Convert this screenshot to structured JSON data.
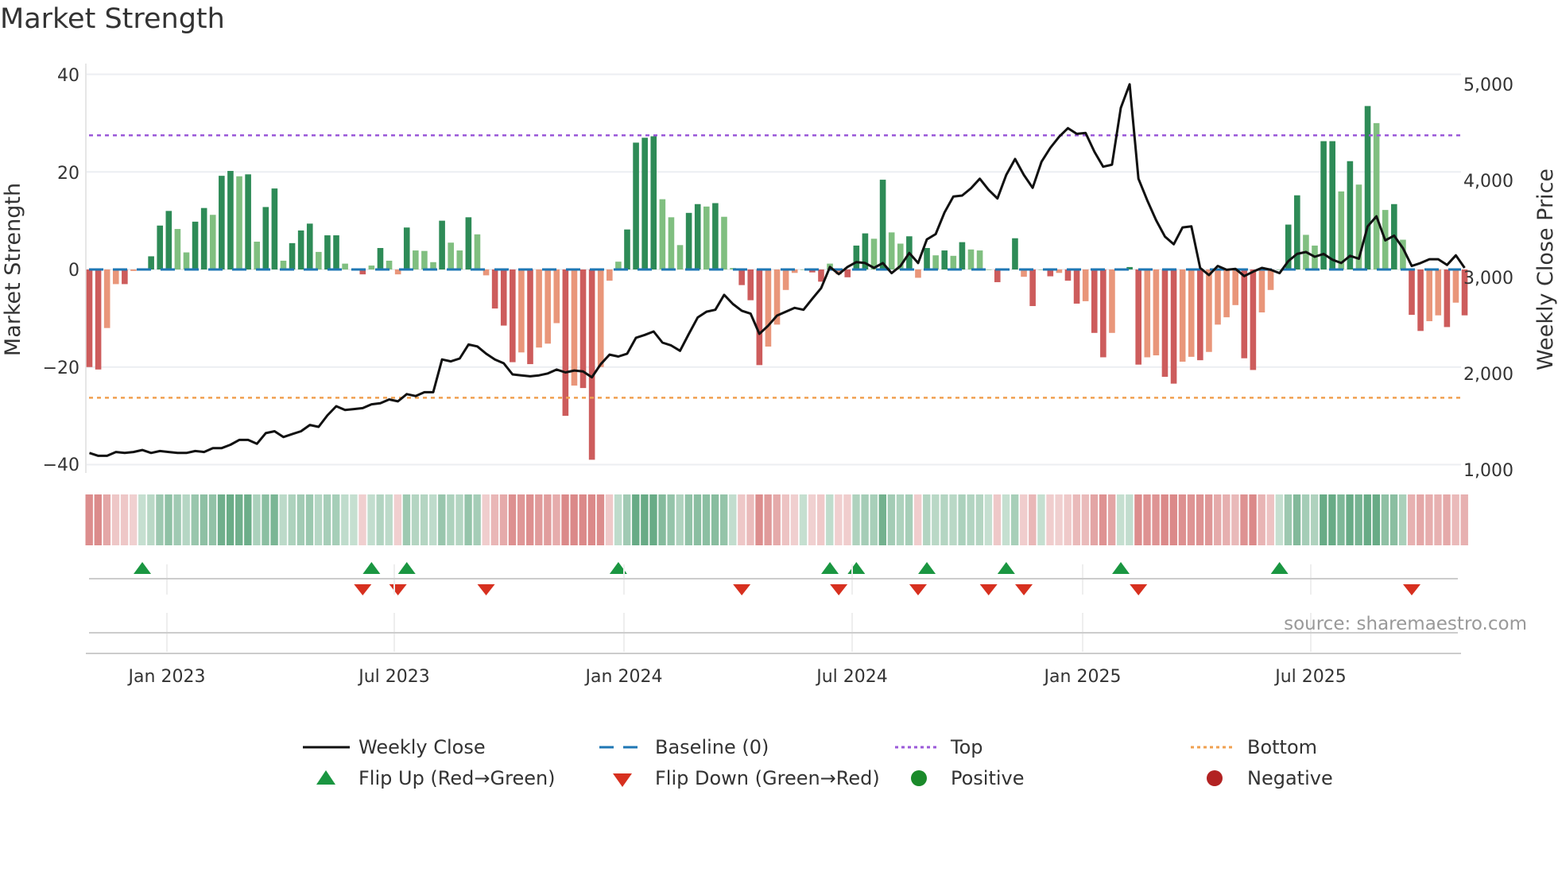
{
  "chart_data": {
    "type": "bar",
    "title": "Market Strength",
    "ylabel": "Market Strength",
    "y2label": "Weekly Close Price",
    "ylim": [
      -40,
      40
    ],
    "y2lim": [
      1000,
      5000
    ],
    "yticks": [
      "40",
      "20",
      "0",
      "−20",
      "−40"
    ],
    "y2ticks": [
      "5,000",
      "4,000",
      "3,000",
      "2,000",
      "1,000"
    ],
    "xticks": [
      "Jan 2023",
      "Jul 2023",
      "Jan 2024",
      "Jul 2024",
      "Jan 2025",
      "Jul 2025"
    ],
    "top_level": 27.5,
    "bottom_level": -26.3,
    "strength": [
      -20,
      -20.5,
      -12,
      -3,
      -3,
      -0.3,
      0,
      2.7,
      9,
      12,
      8.3,
      3.5,
      9.8,
      12.6,
      11.2,
      19.2,
      20.2,
      19.1,
      19.5,
      5.7,
      12.8,
      16.6,
      1.8,
      5.4,
      8,
      9.4,
      3.6,
      7,
      7,
      1.2,
      0,
      -1,
      0.8,
      4.4,
      1.8,
      -1,
      8.6,
      3.9,
      3.8,
      1.5,
      10,
      5.5,
      3.9,
      10.7,
      7.2,
      -1.2,
      -8,
      -11.5,
      -19,
      -17,
      -19.4,
      -16,
      -15.2,
      -11,
      -30,
      -23.8,
      -24.3,
      -39,
      -20,
      -2.3,
      1.6,
      8.2,
      26,
      27,
      27.3,
      14.4,
      10.7,
      5,
      11.6,
      13.4,
      12.9,
      13.6,
      10.8,
      0.3,
      -3.2,
      -6.3,
      -19.6,
      -15.8,
      -11.3,
      -4.2,
      -0.7,
      0,
      -0.6,
      -2.5,
      1.2,
      -1,
      -1.6,
      4.9,
      7.4,
      6.3,
      18.4,
      7.6,
      5.3,
      6.8,
      -1.7,
      4.4,
      2.9,
      3.9,
      2.8,
      5.6,
      4.1,
      3.9,
      0,
      -2.6,
      0,
      6.4,
      -1.5,
      -7.5,
      0,
      -1.4,
      -0.7,
      -2.3,
      -7,
      -6.5,
      -13,
      -18,
      -13,
      0,
      0.5,
      -19.5,
      -18,
      -17.6,
      -22,
      -23.4,
      -18.9,
      -17.9,
      -18.6,
      -16.9,
      -11.3,
      -9.8,
      -7.3,
      -18.2,
      -20.6,
      -8.8,
      -4.2,
      0,
      9.2,
      15.2,
      7.1,
      4.9,
      26.3,
      26.3,
      16,
      22.2,
      17.4,
      33.5,
      30,
      12.2,
      13.4,
      6.1,
      -9.3,
      -12.6,
      -10.6,
      -9.4,
      -11.8,
      -6.8,
      -9.4
    ],
    "weekly_close": [
      1175,
      1145,
      1145,
      1185,
      1175,
      1185,
      1205,
      1175,
      1195,
      1185,
      1175,
      1175,
      1195,
      1185,
      1225,
      1225,
      1260,
      1310,
      1310,
      1270,
      1380,
      1400,
      1340,
      1370,
      1400,
      1465,
      1445,
      1565,
      1660,
      1620,
      1630,
      1640,
      1680,
      1690,
      1730,
      1710,
      1785,
      1765,
      1805,
      1805,
      2145,
      2125,
      2155,
      2300,
      2280,
      2205,
      2145,
      2105,
      1990,
      1980,
      1970,
      1980,
      2000,
      2040,
      2010,
      2030,
      2020,
      1960,
      2095,
      2195,
      2175,
      2205,
      2370,
      2400,
      2435,
      2320,
      2290,
      2235,
      2410,
      2580,
      2640,
      2660,
      2815,
      2720,
      2650,
      2620,
      2410,
      2495,
      2600,
      2640,
      2680,
      2660,
      2775,
      2885,
      3105,
      3030,
      3105,
      3155,
      3145,
      3095,
      3145,
      3040,
      3115,
      3250,
      3145,
      3390,
      3445,
      3670,
      3835,
      3845,
      3920,
      4020,
      3905,
      3815,
      4060,
      4225,
      4060,
      3925,
      4195,
      4340,
      4455,
      4545,
      4485,
      4495,
      4300,
      4145,
      4165,
      4755,
      5000,
      4020,
      3795,
      3590,
      3420,
      3340,
      3515,
      3525,
      3095,
      3020,
      3115,
      3075,
      3085,
      3010,
      3055,
      3095,
      3075,
      3040,
      3165,
      3240,
      3260,
      3210,
      3240,
      3180,
      3145,
      3220,
      3190,
      3525,
      3630,
      3380,
      3430,
      3300,
      3115,
      3145,
      3185,
      3185,
      3125,
      3225,
      3095
    ],
    "flip_up_weeks": [
      6,
      32,
      36,
      60,
      84,
      87,
      95,
      104,
      117,
      135
    ],
    "flip_down_weeks": [
      31,
      35,
      45,
      74,
      85,
      94,
      102,
      106,
      119,
      150
    ],
    "legend": [
      "Weekly Close",
      "Baseline (0)",
      "Top",
      "Bottom",
      "Flip Up (Red→Green)",
      "Flip Down (Green→Red)",
      "Positive",
      "Negative"
    ],
    "legend_placement": "bottom",
    "source": "source: sharemaestro.com",
    "colors": {
      "pos_strong": "#2e8b57",
      "pos_weak": "#80bf80",
      "neg_strong": "#cd5c5c",
      "neg_weak": "#e9967a",
      "line": "#111111",
      "baseline": "#1f77b4",
      "top": "#9b59d9",
      "bottom": "#f0a050",
      "flip_up": "#1a9641",
      "flip_down": "#d7301f",
      "positive": "#1a8a2a",
      "negative": "#b22222"
    }
  }
}
